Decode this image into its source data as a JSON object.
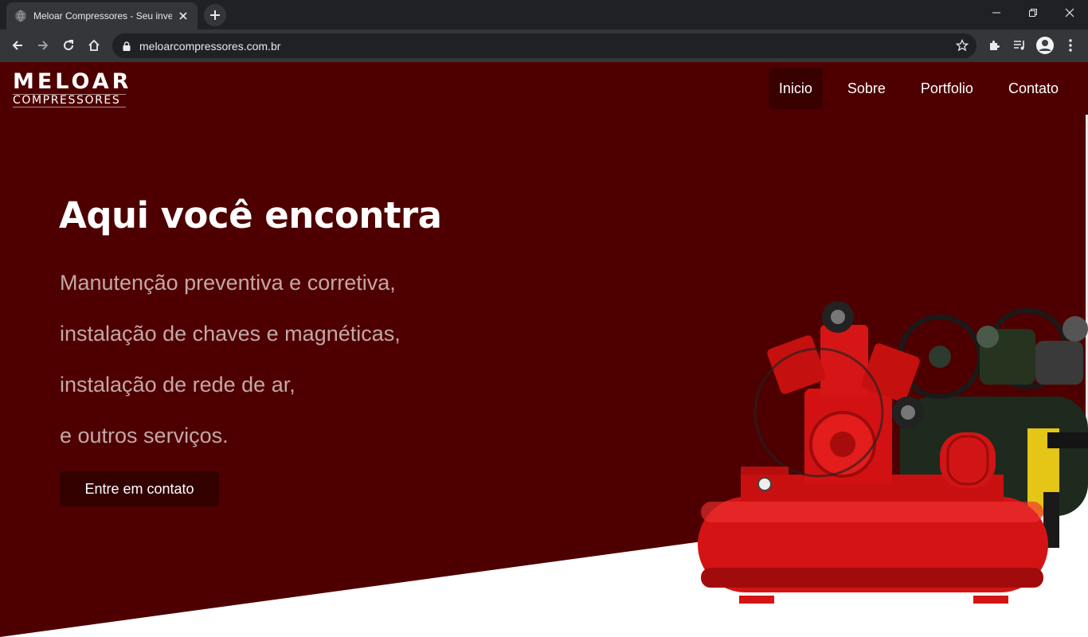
{
  "browser": {
    "tab_title": "Meloar Compressores - Seu investimento",
    "url": "meloarcompressores.com.br"
  },
  "site": {
    "logo_main": "MELOAR",
    "logo_sub": "COMPRESSORES",
    "nav": [
      {
        "label": "Inicio",
        "active": true
      },
      {
        "label": "Sobre",
        "active": false
      },
      {
        "label": "Portfolio",
        "active": false
      },
      {
        "label": "Contato",
        "active": false
      }
    ]
  },
  "hero": {
    "title": "Aqui você encontra",
    "lines": [
      "Manutenção preventiva e corretiva,",
      "instalação de chaves e magnéticas,",
      "instalação de rede de ar,",
      "e outros serviços."
    ],
    "cta": "Entre em contato"
  },
  "colors": {
    "background": "#4e0000",
    "button": "#330000",
    "active_nav": "#390000",
    "subtitle_text": "#c4a7a7"
  }
}
